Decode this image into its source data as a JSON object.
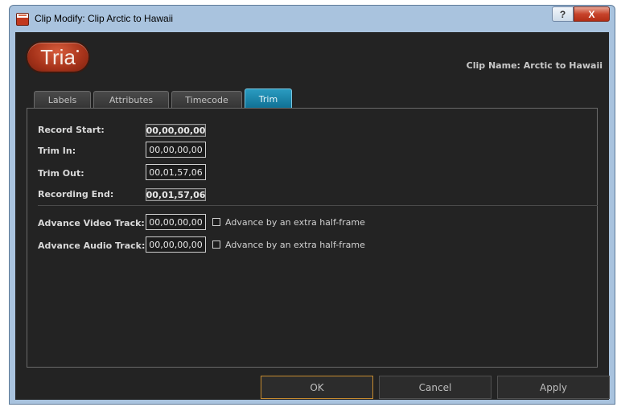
{
  "window": {
    "title": "Clip Modify: Clip Arctic to Hawaii",
    "help_label": "?",
    "close_label": "X"
  },
  "header": {
    "logo_text": "Tria",
    "clip_name": "Clip Name: Arctic to Hawaii"
  },
  "tabs": [
    {
      "label": "Labels"
    },
    {
      "label": "Attributes"
    },
    {
      "label": "Timecode"
    },
    {
      "label": "Trim",
      "active": true
    }
  ],
  "trim": {
    "record_start_label": "Record Start:",
    "record_start_value": "00,00,00,00",
    "trim_in_label": "Trim In:",
    "trim_in_value": "00,00,00,00",
    "trim_out_label": "Trim Out:",
    "trim_out_value": "00,01,57,06",
    "recording_end_label": "Recording End:",
    "recording_end_value": "00,01,57,06",
    "advance_video_label": "Advance Video Track:",
    "advance_video_value": "00,00,00,00",
    "advance_video_halfframe_label": "Advance by an extra half-frame",
    "advance_video_halfframe_checked": false,
    "advance_audio_label": "Advance Audio Track:",
    "advance_audio_value": "00,00,00,00",
    "advance_audio_halfframe_label": "Advance by an extra half-frame",
    "advance_audio_halfframe_checked": false
  },
  "buttons": {
    "ok": "OK",
    "cancel": "Cancel",
    "apply": "Apply"
  },
  "colors": {
    "accent_tab": "#1a86ad",
    "ok_border": "#c58a2f",
    "background": "#232323"
  }
}
